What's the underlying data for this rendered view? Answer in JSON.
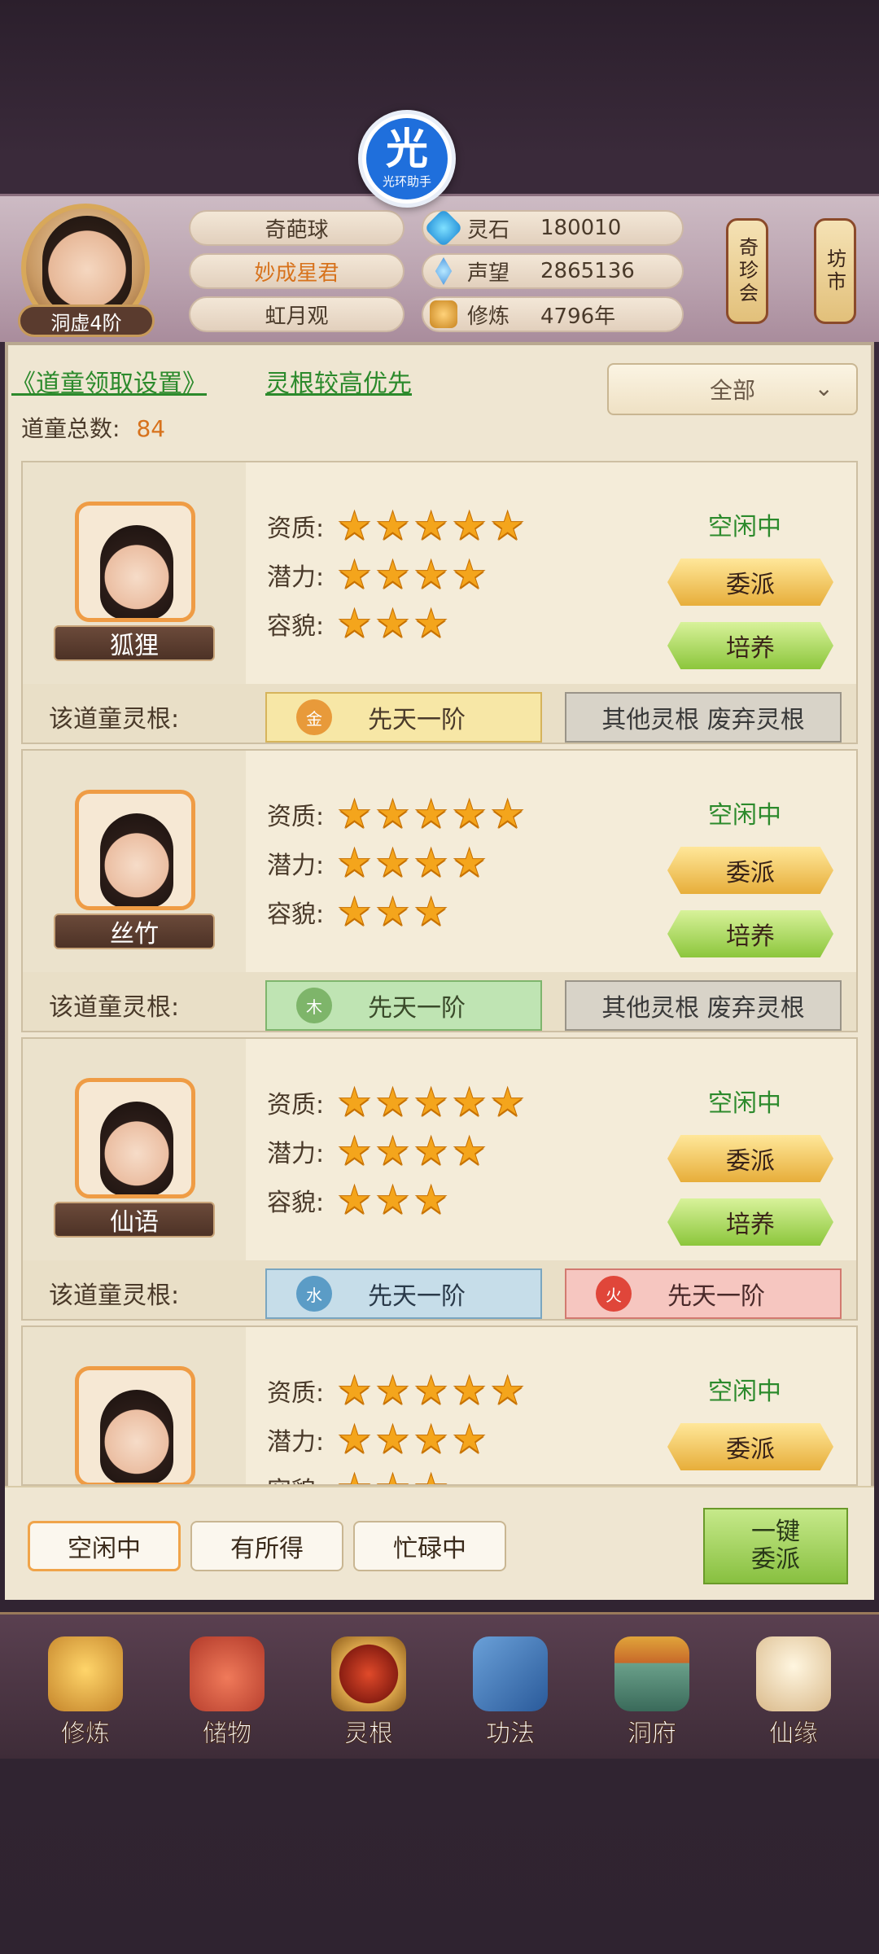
{
  "badge": {
    "glyph": "光",
    "label": "光环助手"
  },
  "player": {
    "rank": "洞虚4阶",
    "names": [
      "奇葩球",
      "妙成星君",
      "虹月观"
    ],
    "name_color": "#d7721c"
  },
  "stats": [
    {
      "icon": "spirit-stone-icon",
      "label": "灵石",
      "value": "180010"
    },
    {
      "icon": "reputation-icon",
      "label": "声望",
      "value": "2865136"
    },
    {
      "icon": "cultivation-icon",
      "label": "修炼",
      "value": "4796年"
    }
  ],
  "side_buttons": [
    "奇珍会",
    "坊市"
  ],
  "settings": {
    "link": "《道童领取设置》",
    "priority": "灵根较高优先"
  },
  "filter_dropdown": {
    "selected": "全部"
  },
  "total": {
    "label": "道童总数:",
    "value": "84"
  },
  "labels": {
    "aptitude": "资质:",
    "potential": "潜力:",
    "appearance": "容貌:",
    "root": "该道童灵根:"
  },
  "cards": [
    {
      "name": "狐狸",
      "aptitude": 5,
      "potential": 4,
      "appearance": 3,
      "status": "空闲中",
      "dispatch": "委派",
      "train": "培养",
      "roots": [
        {
          "type": "gold",
          "element": "金",
          "text": "先天一阶"
        },
        {
          "type": "grey",
          "element": "",
          "text": "其他灵根 废弃灵根"
        }
      ]
    },
    {
      "name": "丝竹",
      "aptitude": 5,
      "potential": 4,
      "appearance": 3,
      "status": "空闲中",
      "dispatch": "委派",
      "train": "培养",
      "roots": [
        {
          "type": "green",
          "element": "木",
          "text": "先天一阶"
        },
        {
          "type": "grey",
          "element": "",
          "text": "其他灵根 废弃灵根"
        }
      ]
    },
    {
      "name": "仙语",
      "aptitude": 5,
      "potential": 4,
      "appearance": 3,
      "status": "空闲中",
      "dispatch": "委派",
      "train": "培养",
      "roots": [
        {
          "type": "blue",
          "element": "水",
          "text": "先天一阶"
        },
        {
          "type": "red",
          "element": "火",
          "text": "先天一阶"
        }
      ]
    },
    {
      "name": "",
      "aptitude": 5,
      "potential": 4,
      "appearance": 3,
      "status": "空闲中",
      "dispatch": "委派",
      "train": "",
      "roots": []
    }
  ],
  "filters": [
    "空闲中",
    "有所得",
    "忙碌中"
  ],
  "active_filter": 0,
  "one_key": "一键\n委派",
  "nav": [
    {
      "icon": "meditation-icon",
      "label": "修炼"
    },
    {
      "icon": "storage-bag-icon",
      "label": "储物"
    },
    {
      "icon": "spirit-root-icon",
      "label": "灵根"
    },
    {
      "icon": "technique-book-icon",
      "label": "功法"
    },
    {
      "icon": "cave-mansion-icon",
      "label": "洞府"
    },
    {
      "icon": "immortal-fate-icon",
      "label": "仙缘"
    }
  ]
}
